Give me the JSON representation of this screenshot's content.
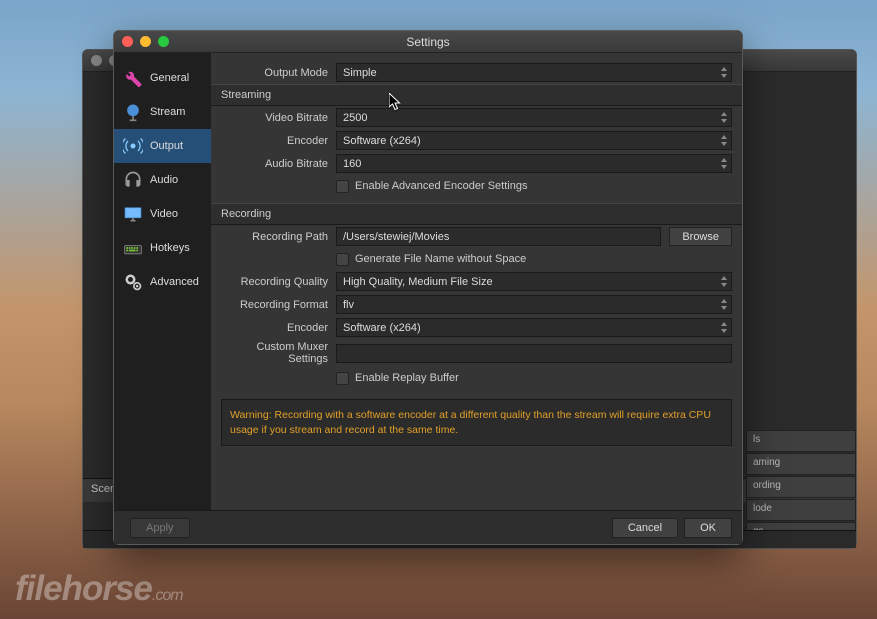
{
  "window_title": "Settings",
  "sidebar": {
    "items": [
      {
        "label": "General"
      },
      {
        "label": "Stream"
      },
      {
        "label": "Output"
      },
      {
        "label": "Audio"
      },
      {
        "label": "Video"
      },
      {
        "label": "Hotkeys"
      },
      {
        "label": "Advanced"
      }
    ]
  },
  "output": {
    "mode_label": "Output Mode",
    "mode_value": "Simple"
  },
  "streaming": {
    "section": "Streaming",
    "video_bitrate_label": "Video Bitrate",
    "video_bitrate_value": "2500",
    "encoder_label": "Encoder",
    "encoder_value": "Software (x264)",
    "audio_bitrate_label": "Audio Bitrate",
    "audio_bitrate_value": "160",
    "advanced_checkbox": "Enable Advanced Encoder Settings"
  },
  "recording": {
    "section": "Recording",
    "path_label": "Recording Path",
    "path_value": "/Users/stewiej/Movies",
    "browse_label": "Browse",
    "gen_filename_checkbox": "Generate File Name without Space",
    "quality_label": "Recording Quality",
    "quality_value": "High Quality, Medium File Size",
    "format_label": "Recording Format",
    "format_value": "flv",
    "encoder_label": "Encoder",
    "encoder_value": "Software (x264)",
    "muxer_label": "Custom Muxer Settings",
    "muxer_value": "",
    "replay_checkbox": "Enable Replay Buffer"
  },
  "warning": "Warning: Recording with a software encoder at a different quality than the stream will require extra CPU usage if you stream and record at the same time.",
  "footer": {
    "apply": "Apply",
    "cancel": "Cancel",
    "ok": "OK"
  },
  "bg": {
    "scenes": "Scen",
    "right_buttons": [
      "ls",
      "aming",
      "ording",
      "lode",
      "gs"
    ]
  },
  "watermark": {
    "main": "filehorse",
    "suffix": ".com"
  }
}
